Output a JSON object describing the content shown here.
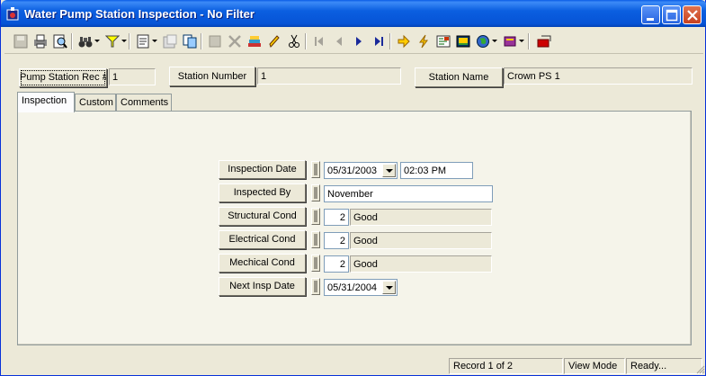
{
  "window": {
    "title": "Water Pump Station Inspection - No Filter"
  },
  "header": {
    "rec_label": "Pump Station Rec #",
    "rec_value": "1",
    "station_number_label": "Station Number",
    "station_number_value": "1",
    "station_name_label": "Station Name",
    "station_name_value": "Crown PS 1"
  },
  "tabs": [
    {
      "label": "Inspection",
      "active": true
    },
    {
      "label": "Custom",
      "active": false
    },
    {
      "label": "Comments",
      "active": false
    }
  ],
  "inspection": {
    "inspection_date_label": "Inspection Date",
    "inspection_date": "05/31/2003",
    "inspection_time": "02:03 PM",
    "inspected_by_label": "Inspected By",
    "inspected_by": "November",
    "structural_label": "Structural Cond",
    "structural_code": "2",
    "structural_text": "Good",
    "electrical_label": "Electrical Cond",
    "electrical_code": "2",
    "electrical_text": "Good",
    "mechanical_label": "Mechical Cond",
    "mechanical_code": "2",
    "mechanical_text": "Good",
    "next_date_label": "Next Insp Date",
    "next_date": "05/31/2004"
  },
  "status": {
    "record": "Record 1 of 2",
    "mode": "View Mode",
    "state": "Ready..."
  },
  "colors": {
    "titlebar": "#0653d6",
    "face": "#ece9d8",
    "field_border": "#7f9db9"
  }
}
